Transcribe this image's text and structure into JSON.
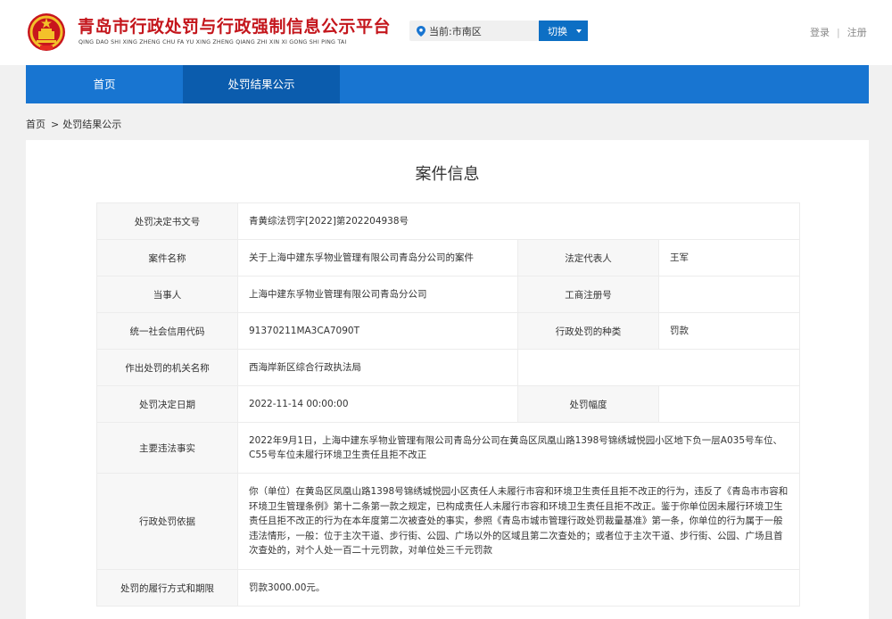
{
  "header": {
    "title": "青岛市行政处罚与行政强制信息公示平台",
    "pinyin": "QING DAO SHI XING ZHENG CHU FA YU XING ZHENG QIANG ZHI XIN XI GONG SHI PING TAI",
    "location": "当前:市南区",
    "switch_label": "切换",
    "login": "登录",
    "divider": "|",
    "register": "注册"
  },
  "nav": {
    "items": [
      "首页",
      "处罚结果公示"
    ],
    "active_index": 1
  },
  "breadcrumb": {
    "home": "首页",
    "arrow": ">",
    "current": "处罚结果公示"
  },
  "panel": {
    "title": "案件信息"
  },
  "case": {
    "doc_no_label": "处罚决定书文号",
    "doc_no": "青黄综法罚字[2022]第202204938号",
    "case_name_label": "案件名称",
    "case_name": "关于上海中建东孚物业管理有限公司青岛分公司的案件",
    "legal_rep_label": "法定代表人",
    "legal_rep": "王军",
    "party_label": "当事人",
    "party": "上海中建东孚物业管理有限公司青岛分公司",
    "reg_no_label": "工商注册号",
    "reg_no": "",
    "credit_code_label": "统一社会信用代码",
    "credit_code": "91370211MA3CA7090T",
    "penalty_type_label": "行政处罚的种类",
    "penalty_type": "罚款",
    "authority_label": "作出处罚的机关名称",
    "authority": "西海岸新区综合行政执法局",
    "date_label": "处罚决定日期",
    "date": "2022-11-14 00:00:00",
    "range_label": "处罚幅度",
    "range": "",
    "facts_label": "主要违法事实",
    "facts": "2022年9月1日，上海中建东孚物业管理有限公司青岛分公司在黄岛区凤凰山路1398号锦绣城悦园小区地下负一层A035号车位、C55号车位未履行环境卫生责任且拒不改正",
    "basis_label": "行政处罚依据",
    "basis": "你（单位）在黄岛区凤凰山路1398号锦绣城悦园小区责任人未履行市容和环境卫生责任且拒不改正的行为，违反了《青岛市市容和环境卫生管理条例》第十二条第一款之规定，已构成责任人未履行市容和环境卫生责任且拒不改正。鉴于你单位因未履行环境卫生责任且拒不改正的行为在本年度第二次被查处的事实，参照《青岛市城市管理行政处罚裁量基准》第一条，你单位的行为属于一般违法情形，一般：位于主次干道、步行街、公园、广场以外的区域且第二次查处的；或者位于主次干道、步行街、公园、广场且首次查处的，对个人处一百二十元罚款，对单位处三千元罚款",
    "performance_label": "处罚的履行方式和期限",
    "performance": "罚款3000.00元。"
  },
  "colors": {
    "title_red": "#c4161c",
    "nav_blue": "#1875d1",
    "nav_active": "#0b5cad",
    "button_blue": "#0d6fc4"
  }
}
